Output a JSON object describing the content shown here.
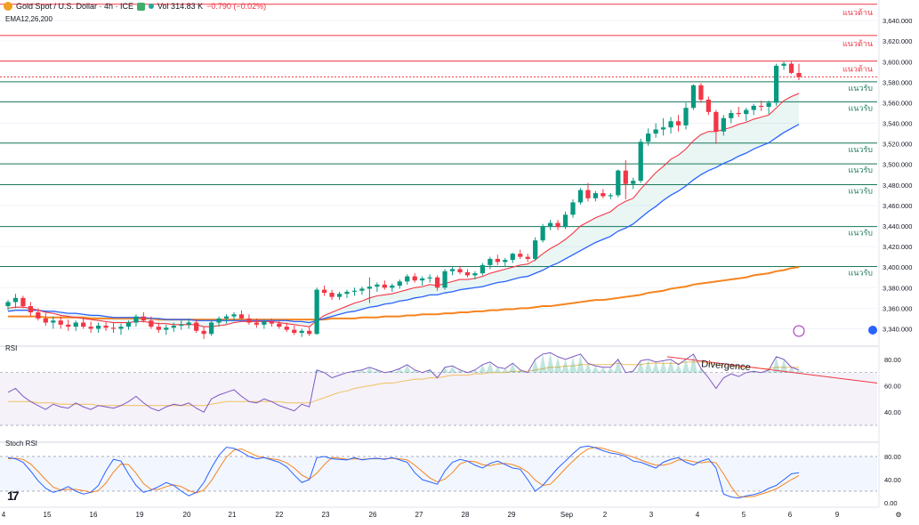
{
  "header": {
    "symbol": "Gold Spot / U.S. Dollar · 4h · ICE",
    "volume": "Vol 314.83 K",
    "change": "−0.790 (−0.02%)",
    "ema_label": "EMA12,26,200"
  },
  "panels": {
    "rsi_label": "RSI",
    "stoch_label": "Stoch RSI",
    "divergence": "Divergence",
    "tv_logo": "17"
  },
  "colors": {
    "up": "#089981",
    "down": "#f23645",
    "res_line": "#f23645",
    "sup_line": "#1f7a5c",
    "ema12": "#f23645",
    "ema26": "#2962ff",
    "ema200": "#f5841f",
    "rsi": "#7e57c2",
    "rsi_ma": "#f0c060",
    "stoch_k": "#2962ff",
    "stoch_d": "#f5841f"
  },
  "chart_data": {
    "type": "candlestick",
    "price_axis": {
      "ylim": [
        3330,
        3660
      ],
      "ticks": [
        "3,640.000",
        "3,620.000",
        "3,600.000",
        "3,580.000",
        "3,560.000",
        "3,540.000",
        "3,520.000",
        "3,500.000",
        "3,480.000",
        "3,460.000",
        "3,440.000",
        "3,420.000",
        "3,400.000",
        "3,380.000",
        "3,360.000",
        "3,340.000"
      ]
    },
    "x_axis": {
      "labels": [
        "4",
        "15",
        "16",
        "19",
        "20",
        "21",
        "22",
        "23",
        "26",
        "27",
        "28",
        "29",
        "Sep",
        "2",
        "3",
        "4",
        "5",
        "6",
        "9",
        "⚙"
      ]
    },
    "levels": [
      {
        "price": "3,655.849",
        "value": 3655.849,
        "label": "แนวต้าน",
        "kind": "resistance"
      },
      {
        "price": "3,625.464",
        "value": 3625.464,
        "label": "แนวต้าน",
        "kind": "resistance"
      },
      {
        "price": "3,600.565",
        "value": 3600.565,
        "label": "แนวต้าน",
        "kind": "resistance"
      },
      {
        "price": "3,580.418",
        "value": 3580.418,
        "label": "แนวรับ",
        "kind": "support"
      },
      {
        "price": "3,560.949",
        "value": 3560.949,
        "label": "แนวรับ",
        "kind": "support"
      },
      {
        "price": "3,520.740",
        "value": 3520.74,
        "label": "แนวรับ",
        "kind": "support"
      },
      {
        "price": "3,500.551",
        "value": 3500.551,
        "label": "แนวรับ",
        "kind": "support"
      },
      {
        "price": "3,480.322",
        "value": 3480.322,
        "label": "แนวรับ",
        "kind": "support"
      },
      {
        "price": "3,439.482",
        "value": 3439.482,
        "label": "แนวรับ",
        "kind": "support"
      },
      {
        "price": "3,400.580",
        "value": 3400.58,
        "label": "แนวรับ",
        "kind": "support"
      }
    ],
    "current_price": {
      "label": "3,585.210",
      "value": 3585.21
    },
    "candles": [
      [
        3362,
        3368,
        3358,
        3366
      ],
      [
        3366,
        3374,
        3360,
        3370
      ],
      [
        3370,
        3372,
        3360,
        3362
      ],
      [
        3362,
        3366,
        3352,
        3356
      ],
      [
        3356,
        3360,
        3348,
        3350
      ],
      [
        3350,
        3355,
        3343,
        3346
      ],
      [
        3346,
        3352,
        3340,
        3348
      ],
      [
        3348,
        3352,
        3340,
        3344
      ],
      [
        3344,
        3349,
        3338,
        3342
      ],
      [
        3342,
        3348,
        3338,
        3346
      ],
      [
        3346,
        3350,
        3340,
        3342
      ],
      [
        3342,
        3347,
        3336,
        3340
      ],
      [
        3340,
        3346,
        3336,
        3343
      ],
      [
        3343,
        3347,
        3338,
        3341
      ],
      [
        3341,
        3346,
        3336,
        3340
      ],
      [
        3340,
        3345,
        3334,
        3342
      ],
      [
        3342,
        3348,
        3339,
        3346
      ],
      [
        3346,
        3354,
        3342,
        3352
      ],
      [
        3352,
        3356,
        3346,
        3348
      ],
      [
        3348,
        3352,
        3340,
        3342
      ],
      [
        3342,
        3346,
        3336,
        3339
      ],
      [
        3339,
        3344,
        3334,
        3341
      ],
      [
        3341,
        3346,
        3337,
        3343
      ],
      [
        3343,
        3348,
        3339,
        3344
      ],
      [
        3344,
        3350,
        3340,
        3346
      ],
      [
        3346,
        3349,
        3336,
        3338
      ],
      [
        3338,
        3342,
        3330,
        3335
      ],
      [
        3335,
        3348,
        3333,
        3346
      ],
      [
        3346,
        3352,
        3342,
        3350
      ],
      [
        3350,
        3354,
        3345,
        3352
      ],
      [
        3352,
        3356,
        3348,
        3354
      ],
      [
        3354,
        3358,
        3349,
        3350
      ],
      [
        3350,
        3354,
        3344,
        3346
      ],
      [
        3346,
        3350,
        3341,
        3344
      ],
      [
        3344,
        3349,
        3340,
        3347
      ],
      [
        3347,
        3350,
        3342,
        3345
      ],
      [
        3345,
        3348,
        3340,
        3342
      ],
      [
        3342,
        3346,
        3337,
        3339
      ],
      [
        3339,
        3343,
        3334,
        3336
      ],
      [
        3336,
        3340,
        3332,
        3338
      ],
      [
        3338,
        3342,
        3333,
        3335
      ],
      [
        3335,
        3380,
        3334,
        3378
      ],
      [
        3378,
        3382,
        3372,
        3375
      ],
      [
        3375,
        3378,
        3368,
        3371
      ],
      [
        3371,
        3376,
        3368,
        3374
      ],
      [
        3374,
        3378,
        3370,
        3376
      ],
      [
        3376,
        3380,
        3372,
        3377
      ],
      [
        3377,
        3381,
        3373,
        3379
      ],
      [
        3379,
        3390,
        3365,
        3381
      ],
      [
        3381,
        3385,
        3376,
        3383
      ],
      [
        3383,
        3387,
        3378,
        3380
      ],
      [
        3380,
        3384,
        3376,
        3382
      ],
      [
        3382,
        3388,
        3379,
        3386
      ],
      [
        3386,
        3393,
        3383,
        3391
      ],
      [
        3391,
        3394,
        3385,
        3387
      ],
      [
        3387,
        3391,
        3382,
        3389
      ],
      [
        3389,
        3393,
        3385,
        3390
      ],
      [
        3390,
        3392,
        3377,
        3380
      ],
      [
        3380,
        3398,
        3378,
        3396
      ],
      [
        3396,
        3400,
        3392,
        3398
      ],
      [
        3398,
        3401,
        3393,
        3395
      ],
      [
        3395,
        3398,
        3390,
        3392
      ],
      [
        3392,
        3396,
        3388,
        3394
      ],
      [
        3394,
        3404,
        3392,
        3402
      ],
      [
        3402,
        3410,
        3398,
        3408
      ],
      [
        3408,
        3412,
        3402,
        3405
      ],
      [
        3405,
        3409,
        3400,
        3407
      ],
      [
        3407,
        3414,
        3404,
        3413
      ],
      [
        3413,
        3417,
        3408,
        3410
      ],
      [
        3410,
        3413,
        3405,
        3408
      ],
      [
        3408,
        3429,
        3406,
        3426
      ],
      [
        3426,
        3442,
        3424,
        3440
      ],
      [
        3440,
        3446,
        3436,
        3443
      ],
      [
        3443,
        3446,
        3436,
        3439
      ],
      [
        3439,
        3454,
        3437,
        3451
      ],
      [
        3451,
        3466,
        3448,
        3463
      ],
      [
        3463,
        3477,
        3461,
        3475
      ],
      [
        3475,
        3482,
        3464,
        3467
      ],
      [
        3467,
        3474,
        3464,
        3472
      ],
      [
        3472,
        3476,
        3467,
        3469
      ],
      [
        3469,
        3472,
        3466,
        3470
      ],
      [
        3470,
        3495,
        3468,
        3494
      ],
      [
        3494,
        3504,
        3466,
        3481
      ],
      [
        3481,
        3487,
        3476,
        3484
      ],
      [
        3484,
        3525,
        3482,
        3522
      ],
      [
        3522,
        3535,
        3518,
        3530
      ],
      [
        3530,
        3540,
        3526,
        3534
      ],
      [
        3534,
        3545,
        3528,
        3536
      ],
      [
        3536,
        3546,
        3530,
        3542
      ],
      [
        3542,
        3548,
        3532,
        3538
      ],
      [
        3538,
        3560,
        3534,
        3555
      ],
      [
        3555,
        3578,
        3553,
        3577
      ],
      [
        3577,
        3579,
        3560,
        3563
      ],
      [
        3563,
        3566,
        3548,
        3551
      ],
      [
        3551,
        3553,
        3520,
        3532
      ],
      [
        3532,
        3548,
        3528,
        3545
      ],
      [
        3545,
        3553,
        3540,
        3550
      ],
      [
        3550,
        3556,
        3546,
        3549
      ],
      [
        3549,
        3555,
        3542,
        3553
      ],
      [
        3553,
        3559,
        3548,
        3557
      ],
      [
        3557,
        3562,
        3552,
        3556
      ],
      [
        3556,
        3562,
        3549,
        3560
      ],
      [
        3560,
        3598,
        3557,
        3596
      ],
      [
        3596,
        3600,
        3592,
        3598
      ],
      [
        3598,
        3600,
        3588,
        3589
      ],
      [
        3589,
        3598,
        3582,
        3585
      ]
    ],
    "ema12": [
      3360,
      3361,
      3361,
      3360,
      3358,
      3356,
      3355,
      3353,
      3352,
      3351,
      3350,
      3349,
      3348,
      3347,
      3346,
      3346,
      3346,
      3347,
      3347,
      3346,
      3345,
      3345,
      3344,
      3344,
      3344,
      3344,
      3342,
      3342,
      3343,
      3344,
      3346,
      3347,
      3347,
      3347,
      3347,
      3347,
      3346,
      3345,
      3344,
      3343,
      3342,
      3348,
      3353,
      3356,
      3359,
      3362,
      3365,
      3367,
      3370,
      3372,
      3373,
      3374,
      3376,
      3378,
      3380,
      3381,
      3383,
      3382,
      3384,
      3386,
      3388,
      3388,
      3389,
      3391,
      3394,
      3396,
      3398,
      3400,
      3402,
      3403,
      3407,
      3413,
      3418,
      3422,
      3427,
      3433,
      3440,
      3444,
      3448,
      3451,
      3454,
      3460,
      3464,
      3467,
      3476,
      3484,
      3492,
      3498,
      3505,
      3509,
      3515,
      3523,
      3529,
      3532,
      3532,
      3534,
      3536,
      3539,
      3541,
      3544,
      3546,
      3548,
      3555,
      3562,
      3566,
      3569
    ],
    "ema26": [
      3357,
      3358,
      3358,
      3358,
      3358,
      3357,
      3357,
      3356,
      3355,
      3355,
      3354,
      3353,
      3353,
      3352,
      3351,
      3351,
      3351,
      3351,
      3351,
      3350,
      3350,
      3349,
      3349,
      3349,
      3349,
      3348,
      3348,
      3348,
      3348,
      3348,
      3348,
      3348,
      3348,
      3348,
      3348,
      3348,
      3348,
      3348,
      3347,
      3347,
      3346,
      3348,
      3350,
      3352,
      3354,
      3356,
      3357,
      3359,
      3361,
      3362,
      3364,
      3365,
      3367,
      3368,
      3370,
      3371,
      3373,
      3373,
      3375,
      3376,
      3378,
      3379,
      3380,
      3381,
      3383,
      3385,
      3386,
      3388,
      3390,
      3391,
      3394,
      3397,
      3401,
      3404,
      3408,
      3412,
      3416,
      3420,
      3424,
      3427,
      3430,
      3435,
      3438,
      3442,
      3448,
      3454,
      3459,
      3465,
      3470,
      3474,
      3479,
      3485,
      3490,
      3494,
      3497,
      3501,
      3504,
      3508,
      3511,
      3515,
      3518,
      3521,
      3526,
      3531,
      3535,
      3539
    ],
    "ema200": [
      3352,
      3352,
      3352,
      3352,
      3352,
      3351,
      3351,
      3351,
      3351,
      3351,
      3351,
      3350,
      3350,
      3350,
      3350,
      3350,
      3350,
      3350,
      3350,
      3350,
      3349,
      3349,
      3349,
      3349,
      3349,
      3349,
      3349,
      3349,
      3349,
      3349,
      3349,
      3349,
      3349,
      3349,
      3349,
      3349,
      3349,
      3349,
      3349,
      3349,
      3349,
      3349,
      3349,
      3350,
      3350,
      3350,
      3350,
      3351,
      3351,
      3351,
      3352,
      3352,
      3352,
      3353,
      3353,
      3354,
      3354,
      3354,
      3355,
      3355,
      3356,
      3356,
      3357,
      3357,
      3358,
      3358,
      3359,
      3359,
      3360,
      3360,
      3361,
      3362,
      3362,
      3363,
      3364,
      3365,
      3366,
      3367,
      3368,
      3368,
      3369,
      3370,
      3371,
      3372,
      3373,
      3375,
      3376,
      3377,
      3379,
      3380,
      3381,
      3383,
      3384,
      3385,
      3386,
      3387,
      3388,
      3389,
      3390,
      3392,
      3393,
      3394,
      3396,
      3397,
      3399,
      3400
    ],
    "rsi_axis": {
      "ylim": [
        30,
        88
      ],
      "ticks": [
        "80.00",
        "60.00",
        "40.00"
      ],
      "bands": [
        30,
        70
      ]
    },
    "rsi": [
      55,
      58,
      52,
      48,
      45,
      42,
      46,
      44,
      43,
      47,
      44,
      42,
      45,
      44,
      43,
      45,
      48,
      52,
      47,
      43,
      41,
      44,
      46,
      45,
      47,
      43,
      40,
      50,
      53,
      55,
      57,
      52,
      48,
      47,
      50,
      48,
      45,
      43,
      41,
      46,
      44,
      72,
      70,
      66,
      68,
      70,
      71,
      72,
      74,
      72,
      70,
      71,
      73,
      76,
      72,
      70,
      72,
      66,
      74,
      75,
      72,
      70,
      72,
      76,
      78,
      74,
      73,
      77,
      72,
      70,
      80,
      84,
      85,
      82,
      80,
      82,
      84,
      77,
      75,
      74,
      74,
      80,
      70,
      71,
      79,
      80,
      78,
      79,
      80,
      76,
      80,
      84,
      73,
      66,
      58,
      66,
      69,
      67,
      70,
      71,
      70,
      72,
      82,
      80,
      74,
      72
    ],
    "rsi_ma": [
      48,
      48,
      48,
      48,
      47,
      47,
      47,
      46,
      46,
      46,
      46,
      46,
      45,
      45,
      45,
      45,
      45,
      45,
      45,
      45,
      45,
      45,
      45,
      45,
      45,
      45,
      45,
      46,
      47,
      48,
      48,
      48,
      48,
      48,
      48,
      48,
      48,
      47,
      47,
      47,
      47,
      49,
      51,
      53,
      55,
      56,
      58,
      59,
      60,
      61,
      62,
      62,
      63,
      64,
      65,
      65,
      66,
      66,
      67,
      68,
      68,
      68,
      69,
      69,
      70,
      70,
      70,
      71,
      71,
      71,
      72,
      73,
      74,
      74,
      75,
      75,
      76,
      76,
      76,
      76,
      76,
      77,
      76,
      76,
      76,
      77,
      77,
      77,
      77,
      77,
      78,
      78,
      78,
      77,
      76,
      75,
      75,
      74,
      74,
      74,
      73,
      73,
      74,
      74,
      74,
      74
    ],
    "stoch_axis": {
      "ylim": [
        0,
        100
      ],
      "ticks": [
        "80.00",
        "40.00",
        "0.00"
      ],
      "bands": [
        20,
        80
      ]
    },
    "stoch_k": [
      78,
      76,
      70,
      55,
      38,
      25,
      18,
      22,
      28,
      20,
      15,
      18,
      30,
      55,
      75,
      72,
      50,
      30,
      18,
      22,
      28,
      35,
      30,
      20,
      12,
      18,
      35,
      60,
      82,
      96,
      94,
      88,
      80,
      76,
      78,
      74,
      70,
      62,
      48,
      35,
      40,
      78,
      80,
      76,
      75,
      74,
      78,
      74,
      76,
      77,
      75,
      78,
      74,
      70,
      52,
      40,
      36,
      32,
      55,
      70,
      75,
      72,
      65,
      60,
      68,
      72,
      66,
      60,
      58,
      40,
      20,
      30,
      45,
      60,
      72,
      85,
      96,
      98,
      95,
      90,
      86,
      84,
      80,
      72,
      70,
      65,
      60,
      70,
      75,
      78,
      70,
      65,
      72,
      76,
      60,
      15,
      10,
      8,
      12,
      14,
      18,
      25,
      30,
      40,
      50,
      52
    ],
    "stoch_d": [
      76,
      77,
      75,
      67,
      54,
      40,
      27,
      22,
      23,
      23,
      21,
      18,
      21,
      34,
      53,
      67,
      66,
      51,
      33,
      23,
      23,
      28,
      31,
      28,
      21,
      17,
      22,
      38,
      59,
      79,
      91,
      93,
      87,
      81,
      78,
      76,
      74,
      69,
      60,
      48,
      41,
      51,
      66,
      78,
      77,
      75,
      76,
      75,
      76,
      76,
      76,
      77,
      76,
      74,
      65,
      54,
      43,
      36,
      41,
      52,
      67,
      72,
      71,
      66,
      64,
      67,
      68,
      66,
      61,
      53,
      39,
      30,
      32,
      45,
      59,
      72,
      84,
      93,
      96,
      94,
      90,
      87,
      83,
      79,
      74,
      69,
      65,
      65,
      68,
      74,
      74,
      71,
      69,
      71,
      69,
      50,
      28,
      11,
      10,
      11,
      15,
      19,
      24,
      32,
      40,
      47
    ]
  }
}
